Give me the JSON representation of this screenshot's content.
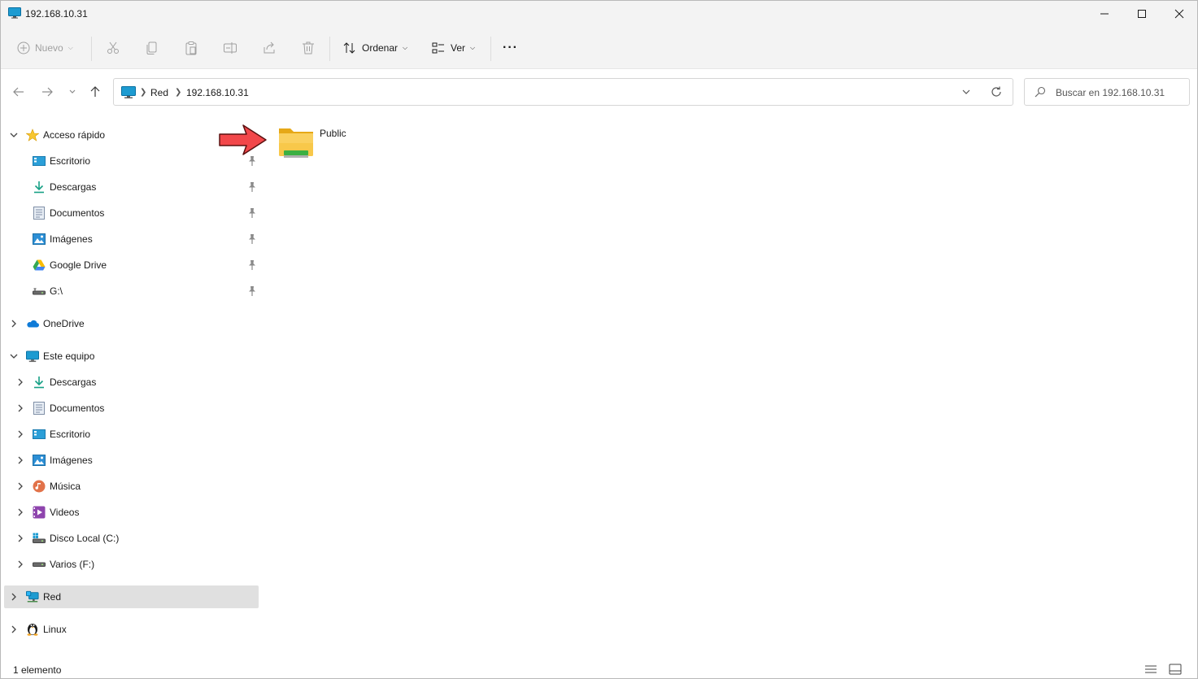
{
  "window": {
    "title": "192.168.10.31"
  },
  "toolbar": {
    "new_label": "Nuevo",
    "sort_label": "Ordenar",
    "view_label": "Ver",
    "more_label": "···"
  },
  "address": {
    "crumbs": [
      "Red",
      "192.168.10.31"
    ]
  },
  "search": {
    "placeholder": "Buscar en 192.168.10.31"
  },
  "sidebar": {
    "quick_access": {
      "label": "Acceso rápido",
      "items": [
        {
          "label": "Escritorio",
          "icon": "desktop-icon"
        },
        {
          "label": "Descargas",
          "icon": "download-icon"
        },
        {
          "label": "Documentos",
          "icon": "document-icon"
        },
        {
          "label": "Imágenes",
          "icon": "pictures-icon"
        },
        {
          "label": "Google Drive",
          "icon": "google-drive-icon"
        },
        {
          "label": "G:\\",
          "icon": "drive-icon"
        }
      ]
    },
    "onedrive": {
      "label": "OneDrive"
    },
    "this_pc": {
      "label": "Este equipo",
      "items": [
        {
          "label": "Descargas",
          "icon": "download-icon"
        },
        {
          "label": "Documentos",
          "icon": "document-icon"
        },
        {
          "label": "Escritorio",
          "icon": "desktop-icon"
        },
        {
          "label": "Imágenes",
          "icon": "pictures-icon"
        },
        {
          "label": "Música",
          "icon": "music-icon"
        },
        {
          "label": "Videos",
          "icon": "video-icon"
        },
        {
          "label": "Disco Local (C:)",
          "icon": "local-disk-icon"
        },
        {
          "label": "Varios (F:)",
          "icon": "drive-icon"
        }
      ]
    },
    "network": {
      "label": "Red"
    },
    "linux": {
      "label": "Linux"
    }
  },
  "content": {
    "items": [
      {
        "name": "Public",
        "type": "shared-folder"
      }
    ]
  },
  "status": {
    "count": "1 elemento"
  },
  "colors": {
    "folder": "#f8c84a",
    "accent": "#0078d4",
    "arrow": "#f2474a",
    "selected": "#e0e0e0"
  }
}
